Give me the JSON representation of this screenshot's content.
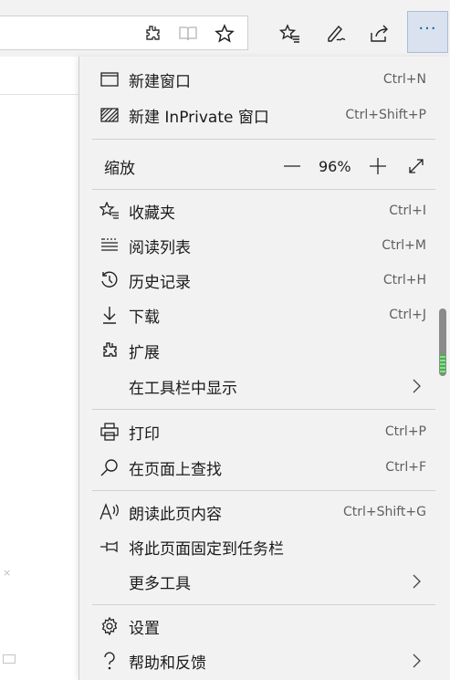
{
  "toolbar": {
    "icons": [
      "extension-icon",
      "reading-view-icon",
      "favorite-star-icon",
      "favorites-hub-icon",
      "notes-pen-icon",
      "share-icon"
    ],
    "more_label": "···"
  },
  "menu": {
    "new_window": {
      "label": "新建窗口",
      "shortcut": "Ctrl+N"
    },
    "new_inprivate": {
      "label": "新建 InPrivate 窗口",
      "shortcut": "Ctrl+Shift+P"
    },
    "zoom": {
      "label": "缩放",
      "value": "96%"
    },
    "favorites": {
      "label": "收藏夹",
      "shortcut": "Ctrl+I"
    },
    "reading_list": {
      "label": "阅读列表",
      "shortcut": "Ctrl+M"
    },
    "history": {
      "label": "历史记录",
      "shortcut": "Ctrl+H"
    },
    "downloads": {
      "label": "下载",
      "shortcut": "Ctrl+J"
    },
    "extensions": {
      "label": "扩展"
    },
    "show_in_toolbar": {
      "label": "在工具栏中显示"
    },
    "print": {
      "label": "打印",
      "shortcut": "Ctrl+P"
    },
    "find_on_page": {
      "label": "在页面上查找",
      "shortcut": "Ctrl+F"
    },
    "read_aloud": {
      "label": "朗读此页内容",
      "shortcut": "Ctrl+Shift+G"
    },
    "pin_taskbar": {
      "label": "将此页面固定到任务栏"
    },
    "more_tools": {
      "label": "更多工具"
    },
    "settings": {
      "label": "设置"
    },
    "help_feedback": {
      "label": "帮助和反馈"
    }
  },
  "page": {
    "close_glyph": "×"
  },
  "colors": {
    "accent": "#0063b1",
    "menu_bg": "#f2f2f2",
    "separator": "#d0d0d0"
  }
}
